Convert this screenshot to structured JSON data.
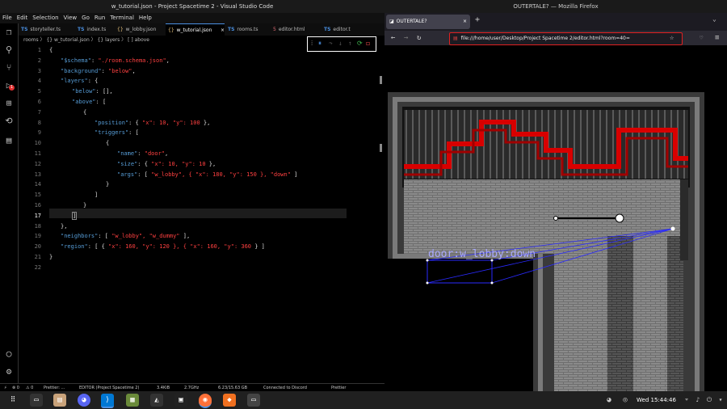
{
  "vscode": {
    "title": "w_tutorial.json - Project Spacetime 2 - Visual Studio Code",
    "menu": [
      "File",
      "Edit",
      "Selection",
      "View",
      "Go",
      "Run",
      "Terminal",
      "Help"
    ],
    "tabs": [
      {
        "icon": "TS",
        "label": "storyteller.ts"
      },
      {
        "icon": "TS",
        "label": "index.ts"
      },
      {
        "icon": "{}",
        "label": "w_lobby.json"
      },
      {
        "icon": "{}",
        "label": "w_tutorial.json",
        "active": true,
        "close": "×"
      },
      {
        "icon": "TS",
        "label": "rooms.ts"
      },
      {
        "icon": "5",
        "label": "editor.html"
      },
      {
        "icon": "TS",
        "label": "editor.t"
      }
    ],
    "breadcrumb": "rooms 〉 {} w_tutorial.json 〉 {} layers 〉 [ ] above",
    "debug_activity_count": "1",
    "lines": [
      {
        "n": "1",
        "text": "{"
      },
      {
        "n": "2",
        "key": "\"$schema\"",
        "colon": ": ",
        "val": "\"./room.schema.json\"",
        "end": ","
      },
      {
        "n": "3",
        "key": "\"background\"",
        "colon": ": ",
        "val": "\"below\"",
        "end": ","
      },
      {
        "n": "4",
        "key": "\"layers\"",
        "colon": ": {",
        "val": "",
        "end": ""
      },
      {
        "n": "5",
        "key": "\"below\"",
        "colon": ": [],",
        "val": "",
        "end": ""
      },
      {
        "n": "6",
        "key": "\"above\"",
        "colon": ": [",
        "val": "",
        "end": ""
      },
      {
        "n": "7",
        "text": "{"
      },
      {
        "n": "8",
        "key": "\"position\"",
        "colon": ": { ",
        "val": "\"x\": 10, \"y\": 100",
        "end": " },"
      },
      {
        "n": "9",
        "key": "\"triggers\"",
        "colon": ": [",
        "val": "",
        "end": ""
      },
      {
        "n": "10",
        "text": "{"
      },
      {
        "n": "11",
        "key": "\"name\"",
        "colon": ": ",
        "val": "\"door\"",
        "end": ","
      },
      {
        "n": "12",
        "key": "\"size\"",
        "colon": ": { ",
        "val": "\"x\": 10, \"y\": 10",
        "end": " },"
      },
      {
        "n": "13",
        "key": "\"args\"",
        "colon": ": [ ",
        "val": "\"w_lobby\", { \"x\": 180, \"y\": 150 }, \"down\"",
        "end": " ]"
      },
      {
        "n": "14",
        "text": "}"
      },
      {
        "n": "15",
        "text": "]"
      },
      {
        "n": "16",
        "text": "}"
      },
      {
        "n": "17",
        "text": "]"
      },
      {
        "n": "18",
        "text": "},"
      },
      {
        "n": "19",
        "key": "\"neighbors\"",
        "colon": ": [ ",
        "val": "\"w_lobby\", \"w_dummy\"",
        "end": " ],"
      },
      {
        "n": "20",
        "key": "\"region\"",
        "colon": ": [ { ",
        "val": "\"x\": 160, \"y\": 120 }, { \"x\": 160, \"y\": 360",
        "end": " } ]"
      },
      {
        "n": "21",
        "text": "}"
      },
      {
        "n": "22",
        "text": ""
      }
    ],
    "status": {
      "remote": "⚡",
      "errors": "⊗ 0",
      "warnings": "⚠ 0",
      "prettier_left": "Prettier: ...",
      "session": "EDITOR (Project Spacetime 2)",
      "stat1": "3.4KiB",
      "stat2": "2.7GHz",
      "stat3": "6.23/15.63 GB",
      "discord": "Connected to Discord",
      "prettier": "Prettier"
    }
  },
  "firefox": {
    "title": "OUTERTALE? — Mozilla Firefox",
    "tab_label": "OUTERTALE?",
    "url": "file:///home/user/Desktop/Project Spacetime 2/editor.html?room=40=",
    "game_overlay_text": "door:w_lobby:down"
  },
  "taskbar": {
    "clock": "Wed 15:44:46"
  },
  "colors": {
    "accent": "#4a90e2",
    "string": "#ff4040",
    "key": "#569cd6"
  }
}
